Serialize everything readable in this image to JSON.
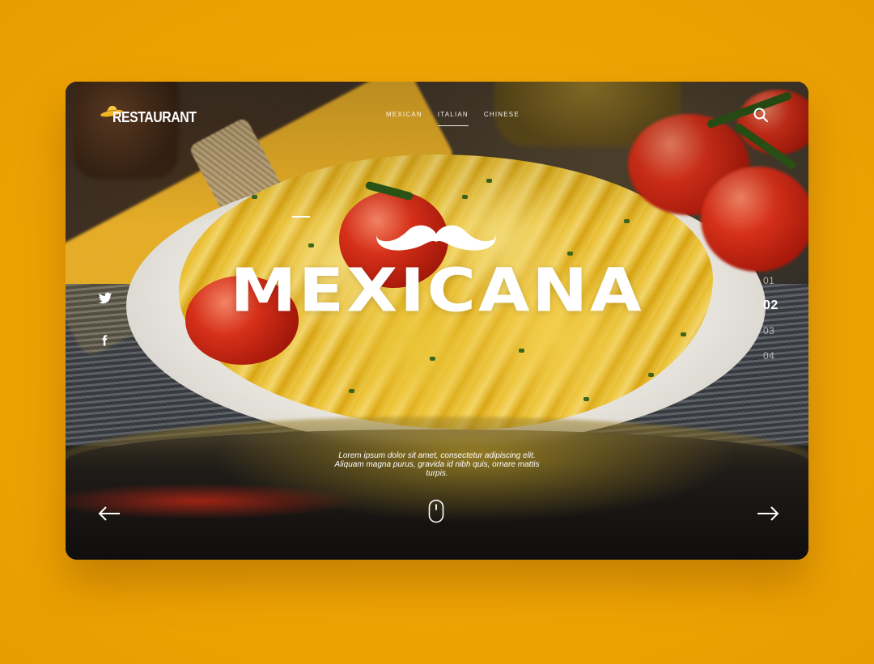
{
  "brand": {
    "logo_text": "RESTAURANT",
    "logo_icon": "sombrero-icon",
    "accent_color": "#eea304"
  },
  "nav": {
    "items": [
      {
        "label": "MEXICAN",
        "active": false
      },
      {
        "label": "ITALIAN",
        "active": true
      },
      {
        "label": "CHINESE",
        "active": false
      }
    ]
  },
  "header": {
    "search_icon": "search-icon"
  },
  "social": {
    "items": [
      {
        "icon": "twitter-icon"
      },
      {
        "icon": "facebook-icon"
      }
    ]
  },
  "hero": {
    "emblem_icon": "mustache-icon",
    "headline": "MEXICANA",
    "description": "Lorem ipsum dolor sit amet, consectetur adipiscing elit. Aliquam magna purus, gravida id nibh quis, ornare mattis turpis."
  },
  "pager": {
    "items": [
      "01",
      "02",
      "03",
      "04"
    ],
    "active_index": 1
  },
  "controls": {
    "prev_icon": "arrow-left-icon",
    "next_icon": "arrow-right-icon",
    "scroll_icon": "mouse-scroll-icon"
  }
}
